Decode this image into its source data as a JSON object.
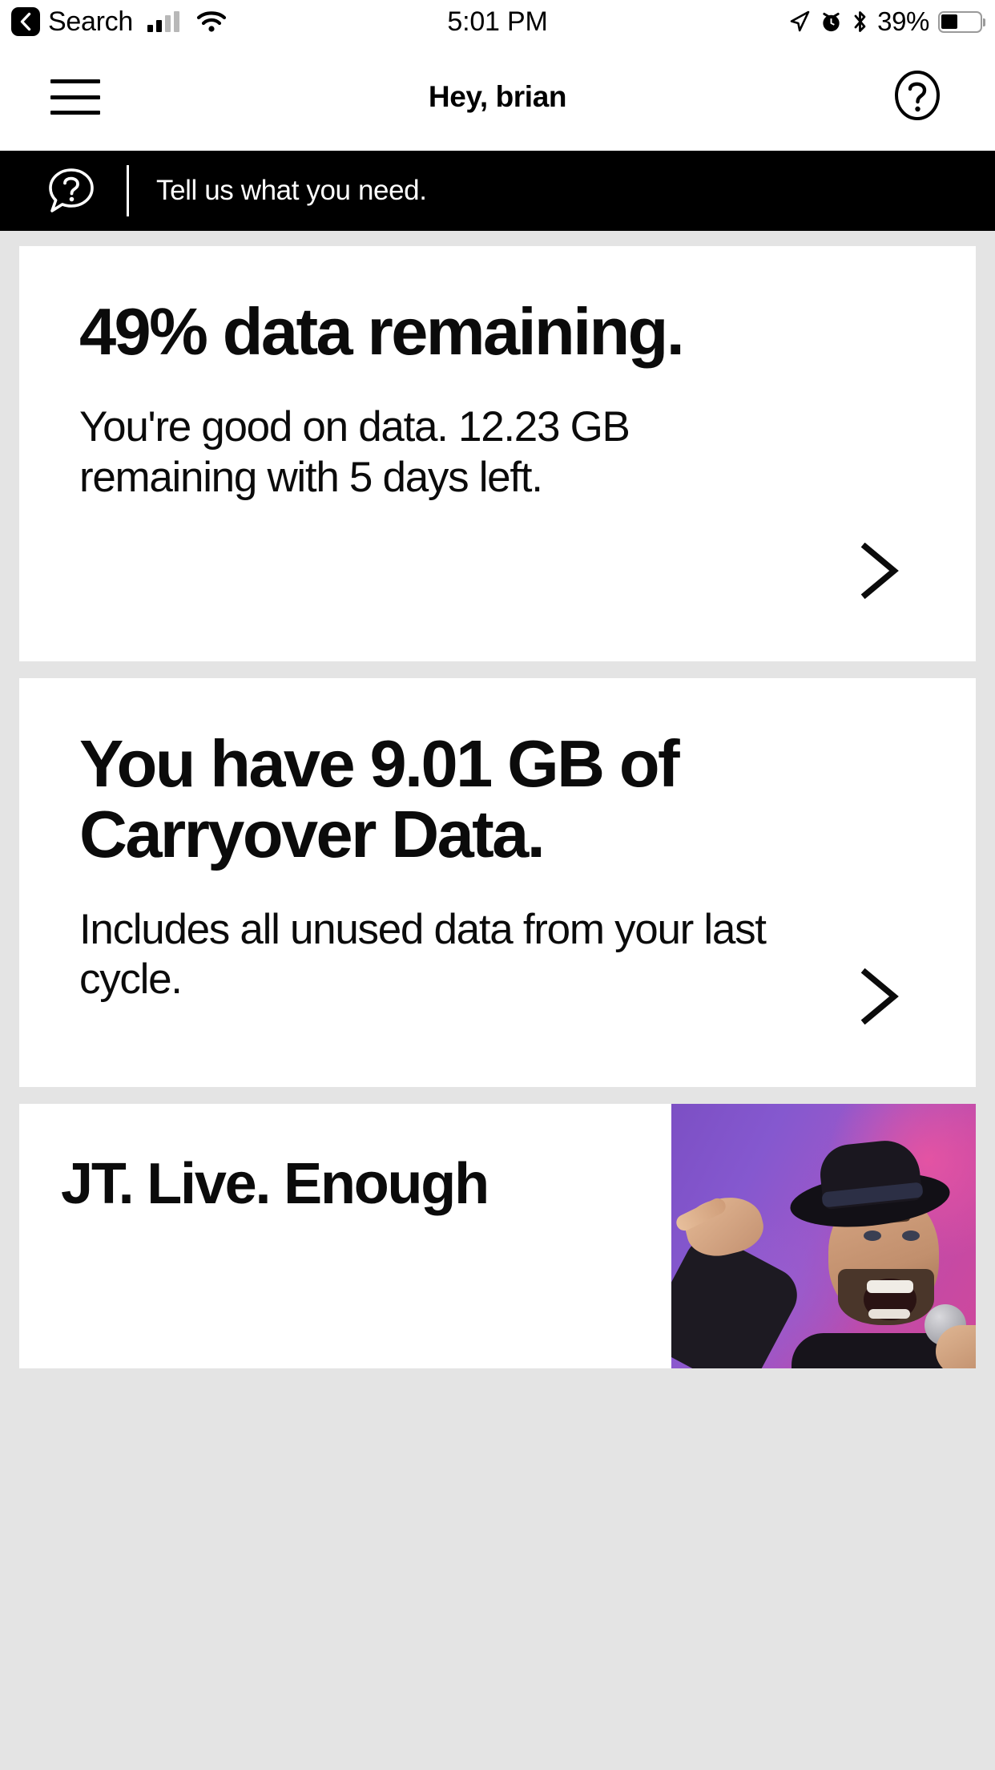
{
  "status_bar": {
    "back_icon": "chevron-left-icon",
    "back_label": "Search",
    "signal_icon": "cellular-signal-icon",
    "wifi_icon": "wifi-icon",
    "time": "5:01 PM",
    "location_icon": "location-arrow-icon",
    "alarm_icon": "alarm-clock-icon",
    "bluetooth_icon": "bluetooth-icon",
    "battery_percent": "39%",
    "battery_icon": "battery-icon"
  },
  "nav": {
    "menu_icon": "hamburger-menu-icon",
    "title": "Hey, brian",
    "help_icon": "help-circle-icon"
  },
  "banner": {
    "icon": "chat-help-bubble-icon",
    "text": "Tell us what you need."
  },
  "cards": [
    {
      "name": "data-remaining-card",
      "heading": "49% data remaining.",
      "body": "You're good on data. 12.23 GB remaining with 5 days left.",
      "chevron_icon": "chevron-right-icon"
    },
    {
      "name": "carryover-data-card",
      "heading": "You have 9.01 GB of Carryover Data.",
      "body": "Includes all unused data from your last cycle.",
      "chevron_icon": "chevron-right-icon"
    }
  ],
  "promo": {
    "name": "jt-live-promo-card",
    "heading": "JT. Live. Enough",
    "image_alt": "performer-photo"
  },
  "colors": {
    "page_background": "#e4e4e4",
    "card_background": "#ffffff",
    "banner_background": "#000000",
    "text_primary": "#0b0b0b",
    "banner_text": "#ffffff",
    "promo_gradient_start": "#7c4fc4",
    "promo_gradient_end": "#d0489b"
  }
}
